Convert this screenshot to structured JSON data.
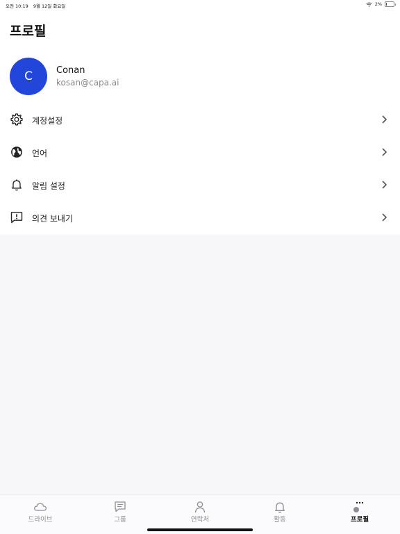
{
  "status_bar": {
    "time": "오전 10:19",
    "date": "9월 12일 화요일",
    "battery": "2%",
    "battery_level": 0.02
  },
  "header": {
    "title": "프로필"
  },
  "profile": {
    "avatar_initial": "C",
    "name": "Conan",
    "email": "kosan@capa.ai",
    "avatar_color": "#2246d9"
  },
  "menu": [
    {
      "label": "계정설정",
      "icon": "gear-icon"
    },
    {
      "label": "언어",
      "icon": "globe-icon"
    },
    {
      "label": "알림 설정",
      "icon": "bell-icon"
    },
    {
      "label": "의견 보내기",
      "icon": "feedback-icon"
    }
  ],
  "tabs": [
    {
      "label": "드라이브",
      "icon": "cloud-icon"
    },
    {
      "label": "그룹",
      "icon": "chat-icon"
    },
    {
      "label": "연락처",
      "icon": "person-icon"
    },
    {
      "label": "활동",
      "icon": "bell-icon"
    },
    {
      "label": "프로필",
      "icon": "more-icon",
      "active": true
    }
  ]
}
